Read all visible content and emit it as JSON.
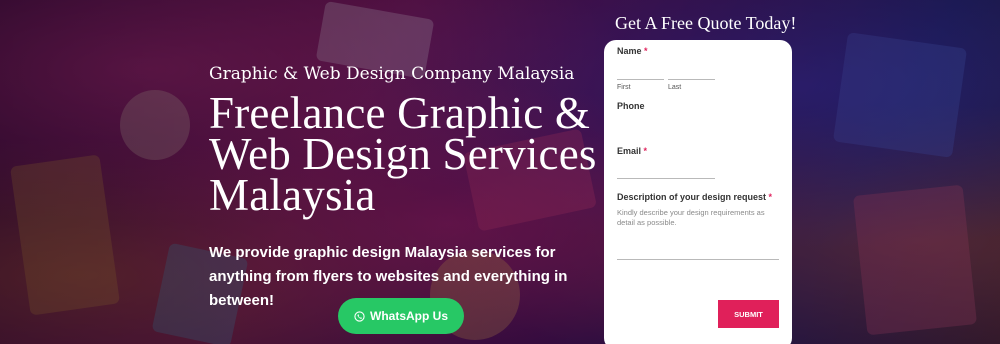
{
  "hero": {
    "kicker": "Graphic & Web Design Company Malaysia",
    "title": "Freelance Graphic & Web Design Services Malaysia",
    "description": "We provide graphic design Malaysia services for anything from flyers to websites and everything in between!",
    "whatsapp_label": "WhatsApp Us",
    "whatsapp_icon": "whatsapp-icon"
  },
  "quote": {
    "title": "Get A Free Quote Today!",
    "name_label": "Name",
    "required_mark": "*",
    "first_label": "First",
    "last_label": "Last",
    "phone_label": "Phone",
    "email_label": "Email",
    "desc_label": "Description of your design request",
    "desc_placeholder": "Kindly describe your design requirements as detail as possible.",
    "submit_label": "SUBMIT"
  },
  "colors": {
    "whatsapp_green": "#27c865",
    "submit_pink": "#e0205a",
    "required_red": "#e0245e"
  }
}
